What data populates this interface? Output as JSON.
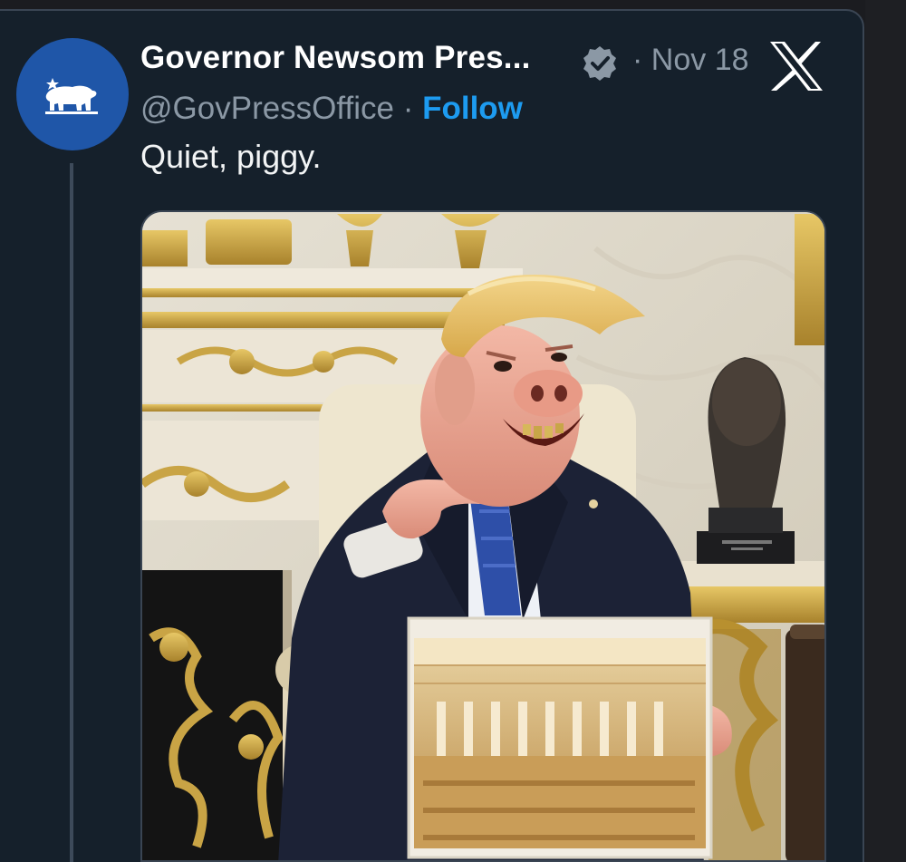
{
  "tweet": {
    "display_name": "Governor Newsom Pres...",
    "separator": "·",
    "date": "Nov 18",
    "handle": "@GovPressOffice",
    "follow_label": "Follow",
    "text": "Quiet, piggy."
  },
  "icons": {
    "avatar": "california-bear-icon",
    "verified": "verified-badge-icon",
    "platform": "x-logo-icon"
  },
  "colors": {
    "card_background": "#15202b",
    "follow_blue": "#1d9bf0",
    "secondary_text": "#8b98a5",
    "avatar_blue": "#1f56a8"
  }
}
